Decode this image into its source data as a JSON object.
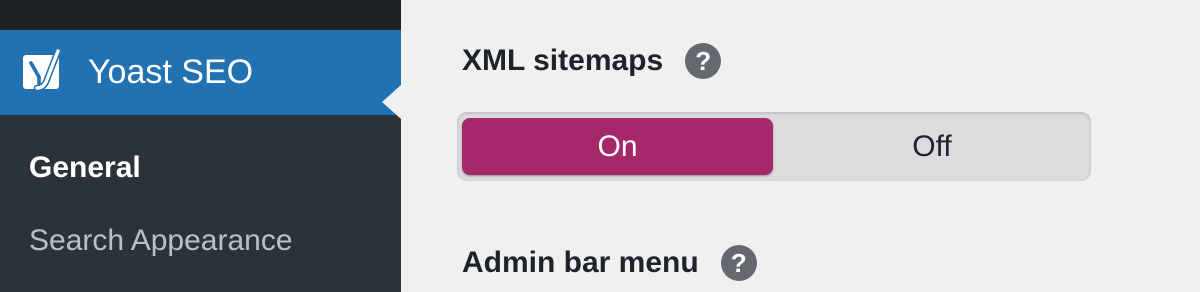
{
  "sidebar": {
    "active_menu": {
      "label": "Yoast SEO",
      "icon": "yoast-logo-icon"
    },
    "submenu": [
      {
        "label": "General",
        "current": true
      },
      {
        "label": "Search Appearance",
        "current": false
      }
    ]
  },
  "main": {
    "xml_sitemaps": {
      "label": "XML sitemaps",
      "help_icon": "?",
      "options": [
        "On",
        "Off"
      ],
      "selected": "On"
    },
    "admin_bar_menu": {
      "label": "Admin bar menu",
      "help_icon": "?"
    }
  },
  "colors": {
    "sidebar_bg": "#2c3338",
    "sidebar_top": "#1d2327",
    "active_menu_bg": "#2271b1",
    "toggle_on_bg": "#a4286a",
    "toggle_track": "#dcdcde",
    "page_bg": "#f0f0f1",
    "help_icon_bg": "#646970"
  }
}
